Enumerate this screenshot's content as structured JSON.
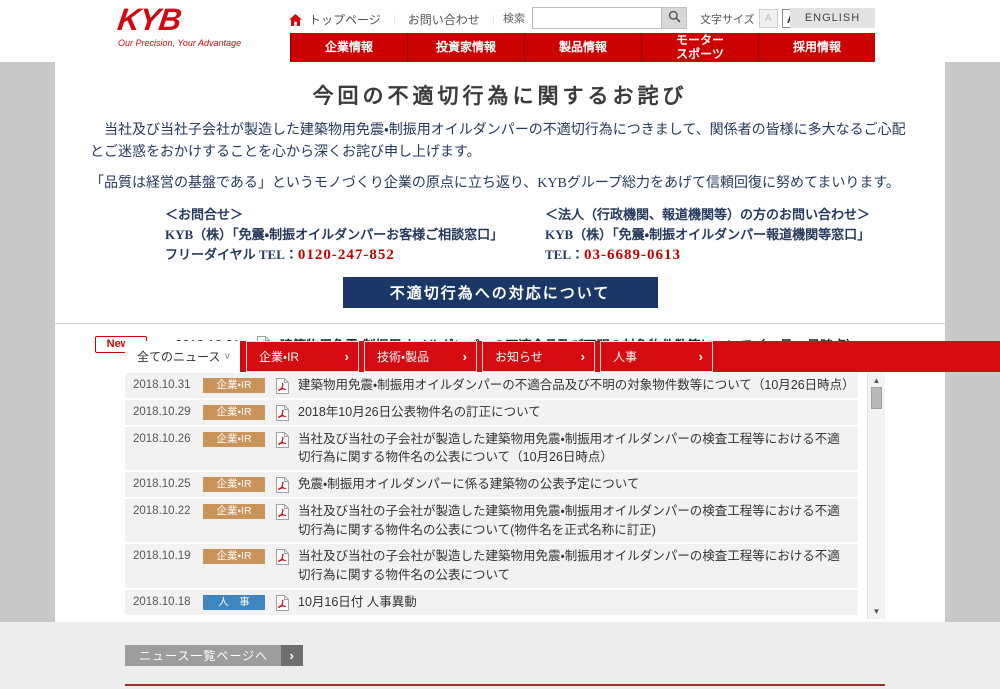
{
  "colors": {
    "brand-red": "#cf0a10",
    "bar-red": "#cc0101",
    "tab-red": "#d40b10",
    "navy-text": "#263a5e",
    "navy-btn": "#1b3767",
    "phone-red": "#c30000",
    "badge-ir": "#c9935a",
    "badge-hr": "#3d86c0",
    "footer-line": "#993028"
  },
  "brand": {
    "logo": "KYB",
    "tagline": "Our Precision, Your Advantage"
  },
  "header": {
    "utility_links": [
      "トップページ",
      "お問い合わせ"
    ],
    "search_label": "検索",
    "font_size_label": "文字サイズ",
    "font_size_small": "A",
    "font_size_large": "A",
    "english_label": "ENGLISH",
    "nav": [
      "企業情報",
      "投資家情報",
      "製品情報",
      "モーター\nスポーツ",
      "採用情報"
    ]
  },
  "main": {
    "title": "今回の不適切行為に関するお詫び",
    "paragraph1": "当社及び当社子会社が製造した建築物用免震・制振用オイルダンパーの不適切行為につきまして、関係者の皆様に多大なるご心配とご迷惑をおかけすることを心から深くお詫び申し上げます。",
    "paragraph2": "「品質は経営の基盤である」というモノづくり企業の原点に立ち返り、KYBグループ総力をあげて信頼回復に努めてまいります。",
    "contact_left": {
      "heading": "＜お問合せ＞",
      "org": "KYB（株）「免震・制振オイルダンパーお客様ご相談窓口」",
      "tel_label": "フリーダイヤル TEL：",
      "tel_number": "0120-247-852"
    },
    "contact_right": {
      "heading": "＜法人（行政機関、報道機関等）の方のお問い合わせ＞",
      "org": "KYB（株）「免震・制振オイルダンパー報道機関等窓口」",
      "tel_label": "TEL：",
      "tel_number": "03-6689-0613"
    },
    "action_button": "不適切行為への対応について"
  },
  "news_highlight": {
    "badge": "News",
    "date": "2018.10.31",
    "title": "建築物用免震・制振用オイルダンパーの不適合品及び不明の対象物件数等について（10月26日時点）"
  },
  "news": {
    "tabs": [
      {
        "label": "全てのニュース",
        "active": true,
        "arrow": "∨",
        "arrow_icon": "chevron-down-icon"
      },
      {
        "label": "企業・IR",
        "arrow": "›",
        "arrow_icon": "arrow-right-icon"
      },
      {
        "label": "技術・製品",
        "arrow": "›",
        "arrow_icon": "arrow-right-icon"
      },
      {
        "label": "お知らせ",
        "arrow": "›",
        "arrow_icon": "arrow-right-icon"
      },
      {
        "label": "人事",
        "arrow": "›",
        "arrow_icon": "arrow-right-icon"
      }
    ],
    "items": [
      {
        "date": "2018.10.31",
        "category": "企業・IR",
        "category_class": "ir",
        "title": "建築物用免震・制振用オイルダンパーの不適合品及び不明の対象物件数等について（10月26日時点）"
      },
      {
        "date": "2018.10.29",
        "category": "企業・IR",
        "category_class": "ir",
        "title": "2018年10月26日公表物件名の訂正について"
      },
      {
        "date": "2018.10.26",
        "category": "企業・IR",
        "category_class": "ir",
        "title": "当社及び当社の子会社が製造した建築物用免震・制振用オイルダンパーの検査工程等における不適切行為に関する物件名の公表について（10月26日時点）"
      },
      {
        "date": "2018.10.25",
        "category": "企業・IR",
        "category_class": "ir",
        "title": "免震・制振用オイルダンパーに係る建築物の公表予定について"
      },
      {
        "date": "2018.10.22",
        "category": "企業・IR",
        "category_class": "ir",
        "title": "当社及び当社の子会社が製造した建築物用免震・制振用オイルダンパーの検査工程等における不適切行為に関する物件名の公表について(物件名を正式名称に訂正)"
      },
      {
        "date": "2018.10.19",
        "category": "企業・IR",
        "category_class": "ir",
        "title": "当社及び当社の子会社が製造した建築物用免震・制振用オイルダンパーの検査工程等における不適切行為に関する物件名の公表について"
      },
      {
        "date": "2018.10.18",
        "category": "人　事",
        "category_class": "hr",
        "title": "10月16日付 人事異動"
      }
    ],
    "more_button": "ニュース一覧ページへ"
  }
}
